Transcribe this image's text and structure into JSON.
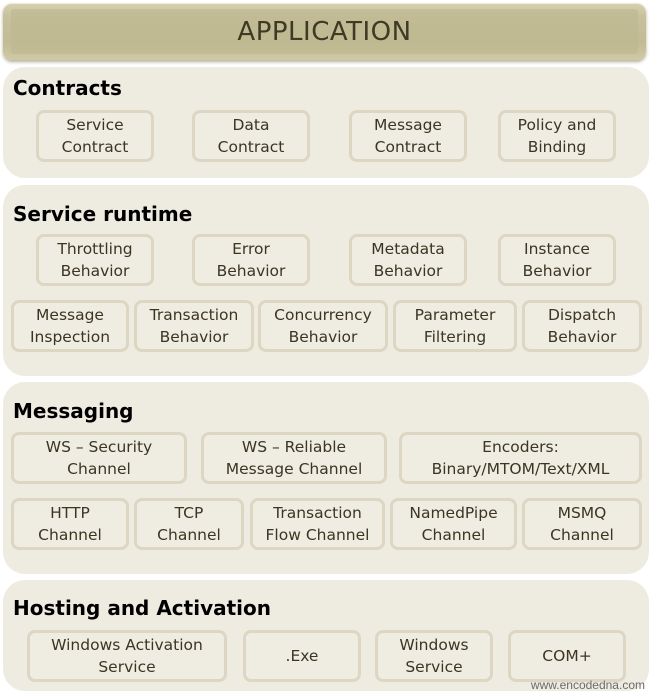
{
  "diagram": {
    "title": "APPLICATION",
    "layers": [
      {
        "name": "Contracts",
        "rows": [
          [
            "Service\nContract",
            "Data\nContract",
            "Message\nContract",
            "Policy and\nBinding"
          ]
        ]
      },
      {
        "name": "Service runtime",
        "rows": [
          [
            "Throttling\nBehavior",
            "Error\nBehavior",
            "Metadata\nBehavior",
            "Instance\nBehavior"
          ],
          [
            "Message\nInspection",
            "Transaction\nBehavior",
            "Concurrency\nBehavior",
            "Parameter\nFiltering",
            "Dispatch\nBehavior"
          ]
        ]
      },
      {
        "name": "Messaging",
        "rows": [
          [
            "WS – Security\nChannel",
            "WS – Reliable\nMessage Channel",
            "Encoders:\nBinary/MTOM/Text/XML"
          ],
          [
            "HTTP\nChannel",
            "TCP\nChannel",
            "Transaction\nFlow Channel",
            "NamedPipe\nChannel",
            "MSMQ\nChannel"
          ]
        ]
      },
      {
        "name": "Hosting and Activation",
        "rows": [
          [
            "Windows Activation\nService",
            ".Exe",
            "Windows\nService",
            "COM+"
          ]
        ]
      }
    ],
    "watermark": "www.encodedna.com"
  }
}
